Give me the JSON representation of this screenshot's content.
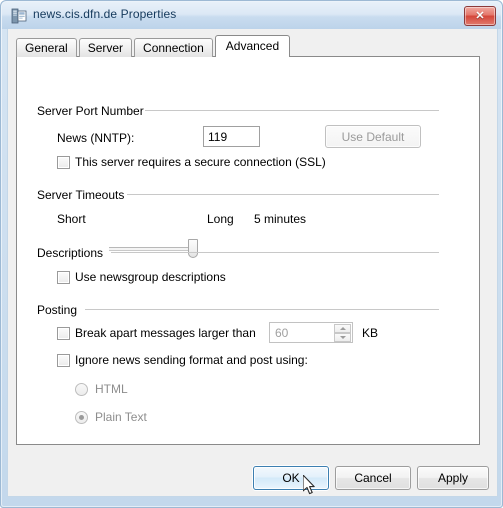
{
  "window": {
    "title": "news.cis.dfn.de Properties",
    "icon": "newsserver-icon",
    "close_label": "✕"
  },
  "tabs": [
    {
      "label": "General",
      "active": false
    },
    {
      "label": "Server",
      "active": false
    },
    {
      "label": "Connection",
      "active": false
    },
    {
      "label": "Advanced",
      "active": true
    }
  ],
  "groups": {
    "server_port": {
      "title": "Server Port Number",
      "nntp_label": "News (NNTP):",
      "nntp_value": "119",
      "use_default_label": "Use Default",
      "ssl_label": "This server requires a secure connection (SSL)",
      "ssl_checked": false
    },
    "server_timeouts": {
      "title": "Server Timeouts",
      "short_label": "Short",
      "long_label": "Long",
      "value_label": "5 minutes"
    },
    "descriptions": {
      "title": "Descriptions",
      "use_descriptions_label": "Use newsgroup descriptions",
      "use_descriptions_checked": false
    },
    "posting": {
      "title": "Posting",
      "break_apart_label": "Break apart messages larger than",
      "break_apart_checked": false,
      "break_apart_value": "60",
      "kb_label": "KB",
      "ignore_format_label": "Ignore news sending format and post using:",
      "ignore_format_checked": false,
      "html_label": "HTML",
      "html_selected": false,
      "plain_text_label": "Plain Text",
      "plain_text_selected": true
    }
  },
  "dialog_buttons": {
    "ok_label": "OK",
    "cancel_label": "Cancel",
    "apply_label": "Apply"
  },
  "colors": {
    "title_text": "#14395c",
    "close_red": "#d4463a",
    "default_button_border": "#3c7fb1",
    "panel_bg": "#ffffff",
    "dialog_bg": "#f0f0f0"
  }
}
